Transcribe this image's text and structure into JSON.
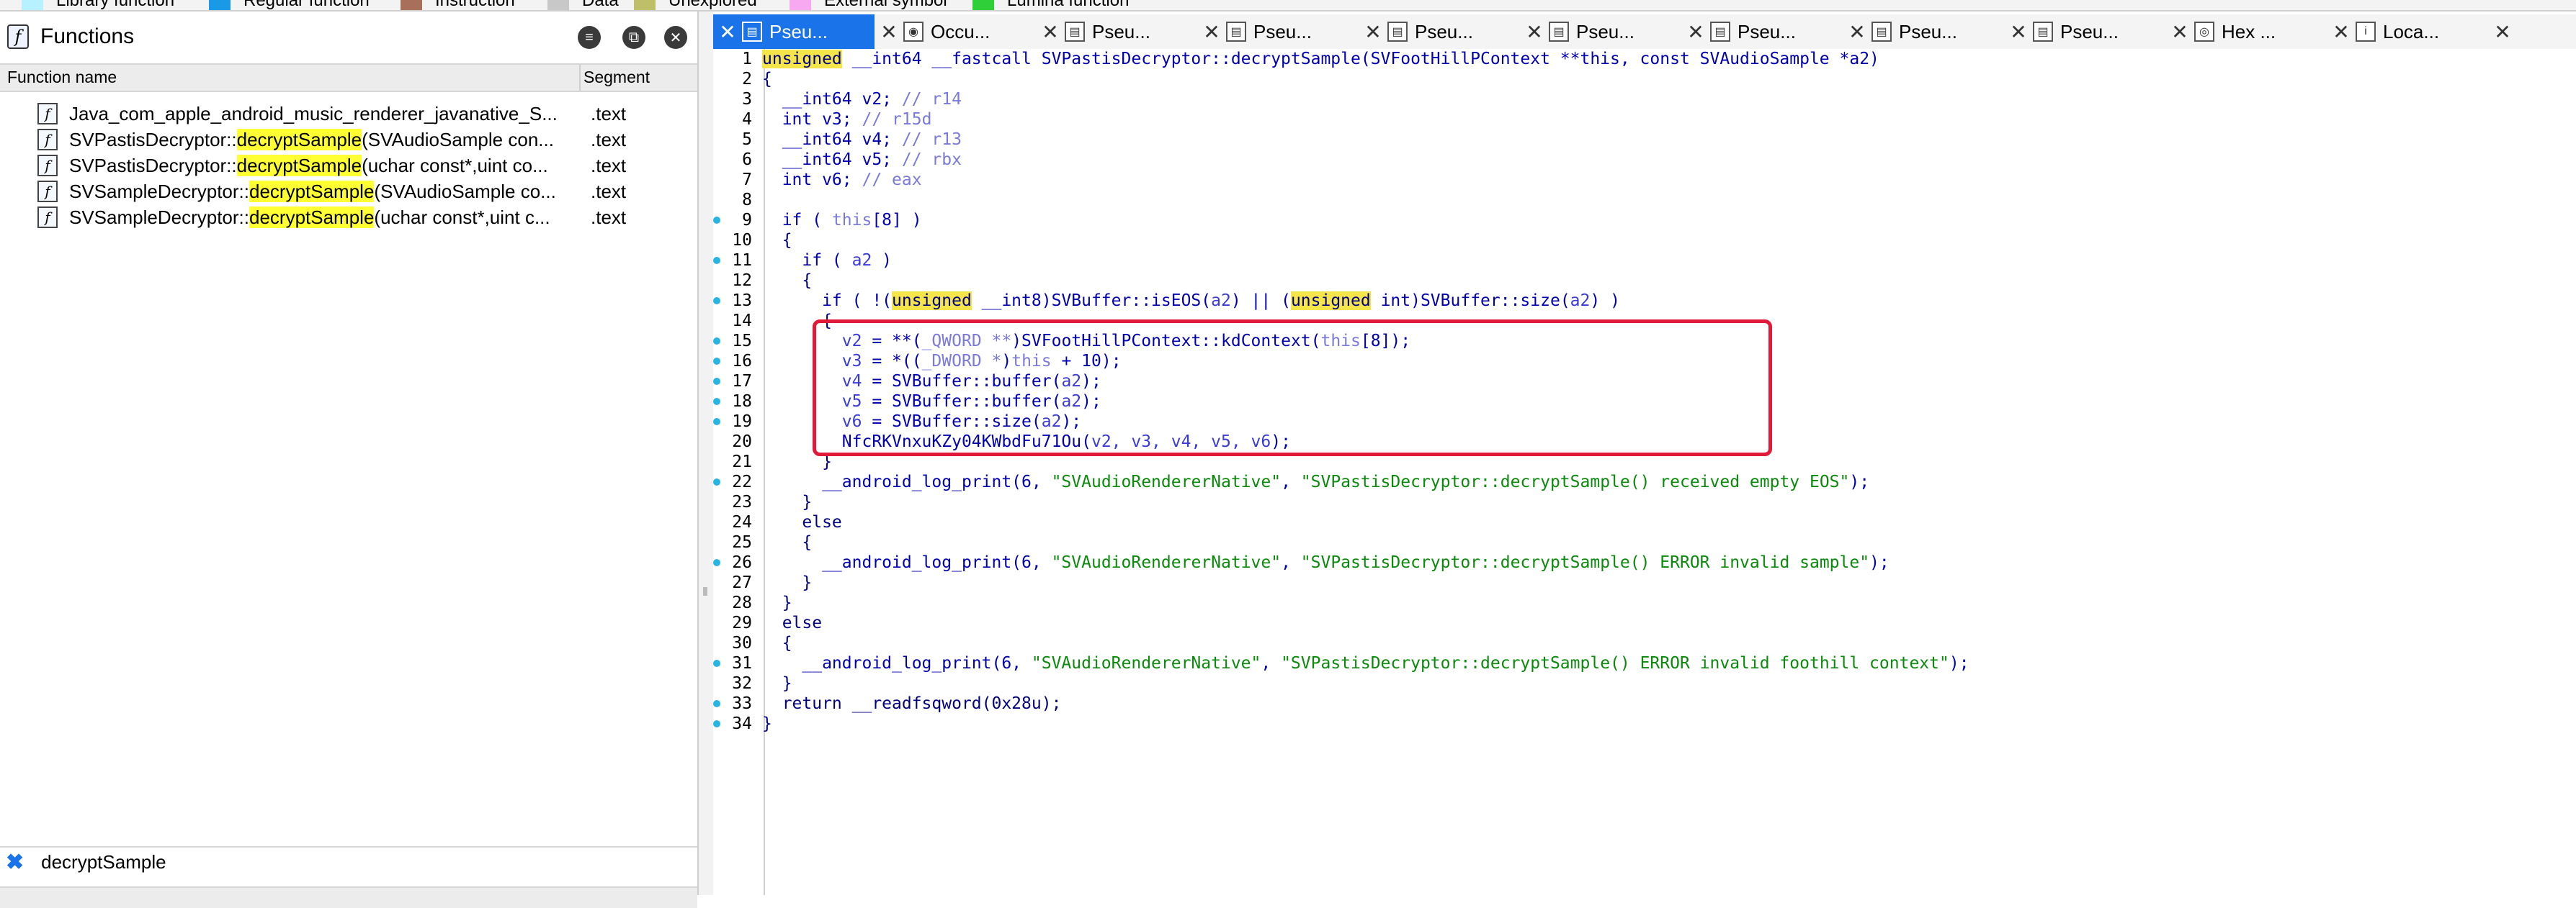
{
  "legend": [
    {
      "label": "Library function",
      "color": "#b7f0ff"
    },
    {
      "label": "Regular function",
      "color": "#1a9ae6"
    },
    {
      "label": "Instruction",
      "color": "#a8705a"
    },
    {
      "label": "Data",
      "color": "#c8c8c8"
    },
    {
      "label": "Unexplored",
      "color": "#bfbf6a"
    },
    {
      "label": "External symbol",
      "color": "#f7a8f0"
    },
    {
      "label": "Lumina function",
      "color": "#2fcf3a"
    }
  ],
  "functions_pane": {
    "title": "Functions",
    "col_name": "Function name",
    "col_segment": "Segment",
    "rows": [
      {
        "pre": "Java_com_apple_android_music_renderer_javanative_S...",
        "hl": "",
        "post": "",
        "segment": ".text"
      },
      {
        "pre": "SVPastisDecryptor::",
        "hl": "decryptSample",
        "post": "(SVAudioSample con...",
        "segment": ".text"
      },
      {
        "pre": "SVPastisDecryptor::",
        "hl": "decryptSample",
        "post": "(uchar const*,uint co...",
        "segment": ".text"
      },
      {
        "pre": "SVSampleDecryptor::",
        "hl": "decryptSample",
        "post": "(SVAudioSample co...",
        "segment": ".text"
      },
      {
        "pre": "SVSampleDecryptor::",
        "hl": "decryptSample",
        "post": "(uchar const*,uint c...",
        "segment": ".text"
      }
    ],
    "search_text": "decryptSample"
  },
  "tabs": [
    {
      "label": "Pseu...",
      "icon": "pseudocode-icon",
      "active": true
    },
    {
      "label": "Occu...",
      "icon": "occurrence-icon",
      "active": false
    },
    {
      "label": "Pseu...",
      "icon": "pseudocode-icon",
      "active": false
    },
    {
      "label": "Pseu...",
      "icon": "pseudocode-icon",
      "active": false
    },
    {
      "label": "Pseu...",
      "icon": "pseudocode-icon",
      "active": false
    },
    {
      "label": "Pseu...",
      "icon": "pseudocode-icon",
      "active": false
    },
    {
      "label": "Pseu...",
      "icon": "pseudocode-icon",
      "active": false
    },
    {
      "label": "Pseu...",
      "icon": "pseudocode-icon",
      "active": false
    },
    {
      "label": "Pseu...",
      "icon": "pseudocode-icon",
      "active": false
    },
    {
      "label": "Hex ...",
      "icon": "hex-view-icon",
      "active": false
    },
    {
      "label": "Loca...",
      "icon": "locals-icon",
      "active": false
    }
  ],
  "code": {
    "line1": {
      "kw": "unsigned",
      "rest": " __int64 __fastcall SVPastisDecryptor::decryptSample(SVFootHillPContext **this, const SVAudioSample *a2)"
    },
    "line2": "{",
    "line3": {
      "decl": "  __int64 v2; ",
      "cm": "// r14"
    },
    "line4": {
      "decl": "  int v3; ",
      "cm": "// r15d"
    },
    "line5": {
      "decl": "  __int64 v4; ",
      "cm": "// r13"
    },
    "line6": {
      "decl": "  __int64 v5; ",
      "cm": "// rbx"
    },
    "line7": {
      "decl": "  int v6; ",
      "cm": "// eax"
    },
    "line9": {
      "a": "  if ( ",
      "th": "this",
      "b": "[8] )"
    },
    "line10": "  {",
    "line11": {
      "a": "    if ( ",
      "v": "a2",
      "b": " )"
    },
    "line12": "    {",
    "line13": {
      "a": "      if ( !(",
      "kw1": "unsigned",
      "b": " __int8)SVBuffer::isEOS(",
      "v1": "a2",
      "c": ") || (",
      "kw2": "unsigned",
      "d": " int)SVBuffer::size(",
      "v2": "a2",
      "e": ") )"
    },
    "line14": "      {",
    "line15": {
      "a": "        ",
      "v": "v2",
      "b": " = **(",
      "cast": "_QWORD **",
      "c": ")SVFootHillPContext::kdContext(",
      "th": "this",
      "d": "[8]);"
    },
    "line16": {
      "a": "        ",
      "v": "v3",
      "b": " = *((",
      "cast": "_DWORD *",
      "c": ")",
      "th": "this",
      "d": " + 10);"
    },
    "line17": {
      "a": "        ",
      "v": "v4",
      "b": " = SVBuffer::buffer(",
      "arg": "a2",
      "c": ");"
    },
    "line18": {
      "a": "        ",
      "v": "v5",
      "b": " = SVBuffer::buffer(",
      "arg": "a2",
      "c": ");"
    },
    "line19": {
      "a": "        ",
      "v": "v6",
      "b": " = SVBuffer::size(",
      "arg": "a2",
      "c": ");"
    },
    "line20": {
      "a": "        NfcRKVnxuKZy04KWbdFu71Ou(",
      "v": "v2, v3, v4, v5, v6",
      "b": ");"
    },
    "line21": "      }",
    "line22": {
      "a": "      __android_log_print(6, ",
      "s1": "\"SVAudioRendererNative\"",
      "b": ", ",
      "s2": "\"SVPastisDecryptor::decryptSample() received empty EOS\"",
      "c": ");"
    },
    "line23": "    }",
    "line24": "    else",
    "line25": "    {",
    "line26": {
      "a": "      __android_log_print(6, ",
      "s1": "\"SVAudioRendererNative\"",
      "b": ", ",
      "s2": "\"SVPastisDecryptor::decryptSample() ERROR invalid sample\"",
      "c": ");"
    },
    "line27": "    }",
    "line28": "  }",
    "line29": "  else",
    "line30": "  {",
    "line31": {
      "a": "    __android_log_print(6, ",
      "s1": "\"SVAudioRendererNative\"",
      "b": ", ",
      "s2": "\"SVPastisDecryptor::decryptSample() ERROR invalid foothill context\"",
      "c": ");"
    },
    "line32": "  }",
    "line33": "  return __readfsqword(0x28u);",
    "line34": "}"
  },
  "line_numbers": [
    "1",
    "2",
    "3",
    "4",
    "5",
    "6",
    "7",
    "8",
    "9",
    "10",
    "11",
    "12",
    "13",
    "14",
    "15",
    "16",
    "17",
    "18",
    "19",
    "20",
    "21",
    "22",
    "23",
    "24",
    "25",
    "26",
    "27",
    "28",
    "29",
    "30",
    "31",
    "32",
    "33",
    "34"
  ],
  "colors": {
    "accent": "#1a73e8",
    "highlight": "#ffff33",
    "annotation_box": "#e21a3a",
    "breakpoint_dot": "#27b5e6"
  }
}
